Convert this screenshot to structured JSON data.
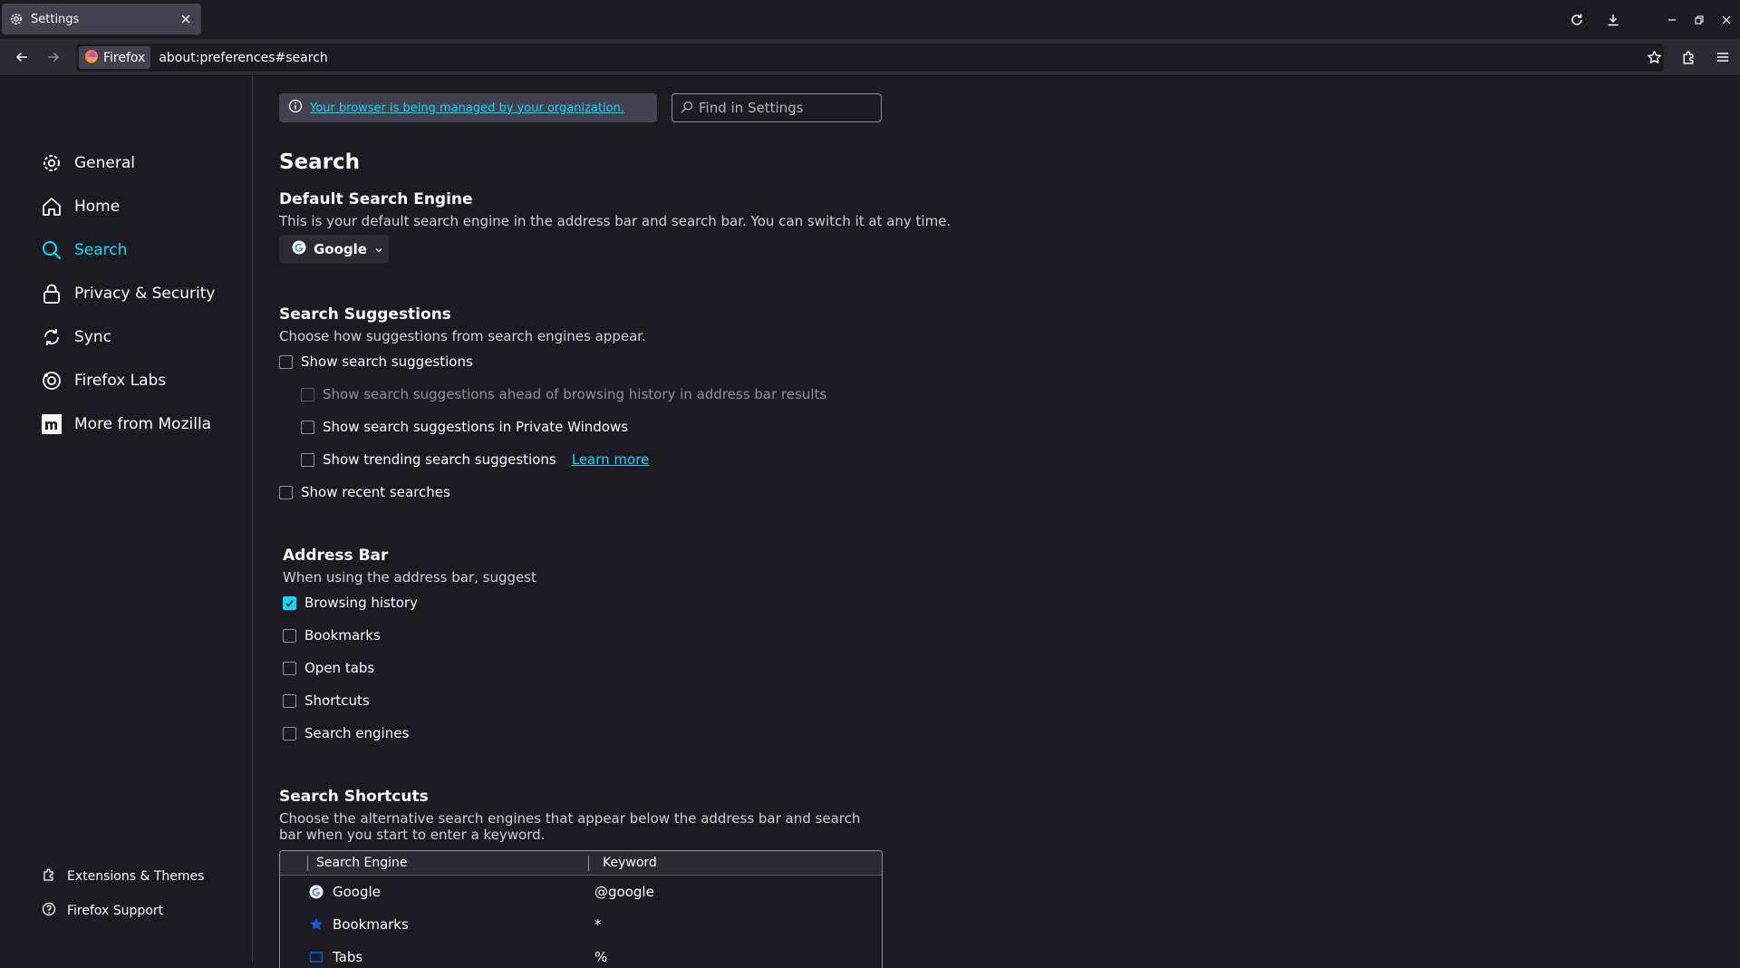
{
  "colors": {
    "accent": "#00ddff",
    "background": "#1c1b22",
    "toolbar": "#2b2a33",
    "text": "#fbfbfe"
  },
  "tab": {
    "title": "Settings",
    "icon": "gear-icon"
  },
  "urlbar": {
    "identity_label": "Firefox",
    "url": "about:preferences#search"
  },
  "sidebar": {
    "categories": [
      {
        "label": "General",
        "icon": "gear-icon"
      },
      {
        "label": "Home",
        "icon": "home-icon"
      },
      {
        "label": "Search",
        "icon": "search-icon",
        "active": true
      },
      {
        "label": "Privacy & Security",
        "icon": "lock-icon"
      },
      {
        "label": "Sync",
        "icon": "sync-icon"
      },
      {
        "label": "Firefox Labs",
        "icon": "labs-icon"
      },
      {
        "label": "More from Mozilla",
        "icon": "mozilla-icon"
      }
    ],
    "footer": [
      {
        "label": "Extensions & Themes",
        "icon": "puzzle-icon"
      },
      {
        "label": "Firefox Support",
        "icon": "help-icon"
      }
    ]
  },
  "header": {
    "policies_link": "Your browser is being managed by your organization.",
    "find_placeholder": "Find in Settings"
  },
  "main": {
    "title": "Search",
    "default_engine": {
      "heading": "Default Search Engine",
      "description": "This is your default search engine in the address bar and search bar. You can switch it at any time.",
      "selected": "Google"
    },
    "suggestions": {
      "heading": "Search Suggestions",
      "description": "Choose how suggestions from search engines appear.",
      "options": [
        {
          "label": "Show search suggestions",
          "checked": false
        },
        {
          "label": "Show search suggestions ahead of browsing history in address bar results",
          "checked": false,
          "disabled": true
        },
        {
          "label": "Show search suggestions in Private Windows",
          "checked": false
        },
        {
          "label": "Show trending search suggestions",
          "checked": false,
          "link": "Learn more"
        },
        {
          "label": "Show recent searches",
          "checked": false
        }
      ]
    },
    "address_bar": {
      "heading": "Address Bar",
      "description": "When using the address bar, suggest",
      "options": [
        {
          "label": "Browsing history",
          "checked": true
        },
        {
          "label": "Bookmarks",
          "checked": false
        },
        {
          "label": "Open tabs",
          "checked": false
        },
        {
          "label": "Shortcuts",
          "checked": false
        },
        {
          "label": "Search engines",
          "checked": false
        }
      ]
    },
    "shortcuts": {
      "heading": "Search Shortcuts",
      "description": "Choose the alternative search engines that appear below the address bar and search bar when you start to enter a keyword.",
      "columns": [
        "Search Engine",
        "Keyword"
      ],
      "rows": [
        {
          "name": "Google",
          "keyword": "@google",
          "icon": "google-icon"
        },
        {
          "name": "Bookmarks",
          "keyword": "*",
          "icon": "star-icon"
        },
        {
          "name": "Tabs",
          "keyword": "%",
          "icon": "tab-icon"
        }
      ]
    }
  }
}
